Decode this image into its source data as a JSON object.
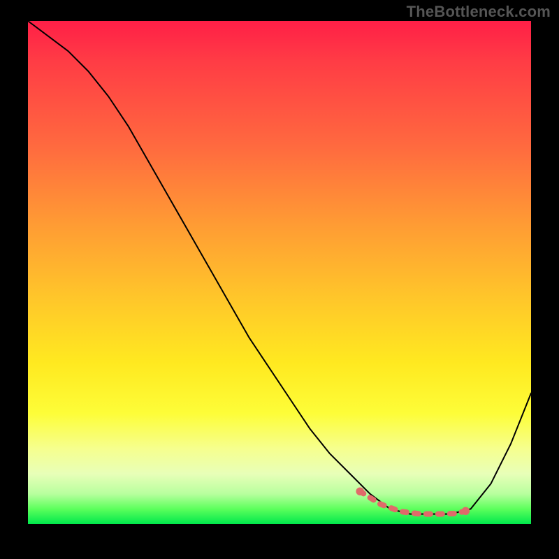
{
  "watermark": "TheBottleneck.com",
  "chart_data": {
    "type": "line",
    "title": "",
    "xlabel": "",
    "ylabel": "",
    "xlim": [
      0,
      100
    ],
    "ylim": [
      0,
      100
    ],
    "curve": {
      "description": "Bottleneck curve: high at left, drops to a flat minimum near x≈72–85, rises again toward right edge",
      "x": [
        0,
        4,
        8,
        12,
        16,
        20,
        24,
        28,
        32,
        36,
        40,
        44,
        48,
        52,
        56,
        60,
        64,
        68,
        72,
        76,
        80,
        84,
        88,
        92,
        96,
        100
      ],
      "y": [
        100,
        97,
        94,
        90,
        85,
        79,
        72,
        65,
        58,
        51,
        44,
        37,
        31,
        25,
        19,
        14,
        10,
        6,
        3,
        2,
        2,
        2,
        3,
        8,
        16,
        26
      ]
    },
    "minimum_band": {
      "description": "Highlighted near-optimal region along the valley floor (pink dashed segment)",
      "x": [
        66,
        70,
        74,
        78,
        82,
        85,
        87
      ],
      "y": [
        6.5,
        4.0,
        2.5,
        2.0,
        2.0,
        2.1,
        2.6
      ]
    },
    "background_gradient_stops": [
      {
        "pos": 0.0,
        "color": "#ff1f47"
      },
      {
        "pos": 0.25,
        "color": "#ff6a3f"
      },
      {
        "pos": 0.55,
        "color": "#ffc62a"
      },
      {
        "pos": 0.78,
        "color": "#fdfd38"
      },
      {
        "pos": 0.94,
        "color": "#b8ff9e"
      },
      {
        "pos": 1.0,
        "color": "#00e84c"
      }
    ]
  }
}
